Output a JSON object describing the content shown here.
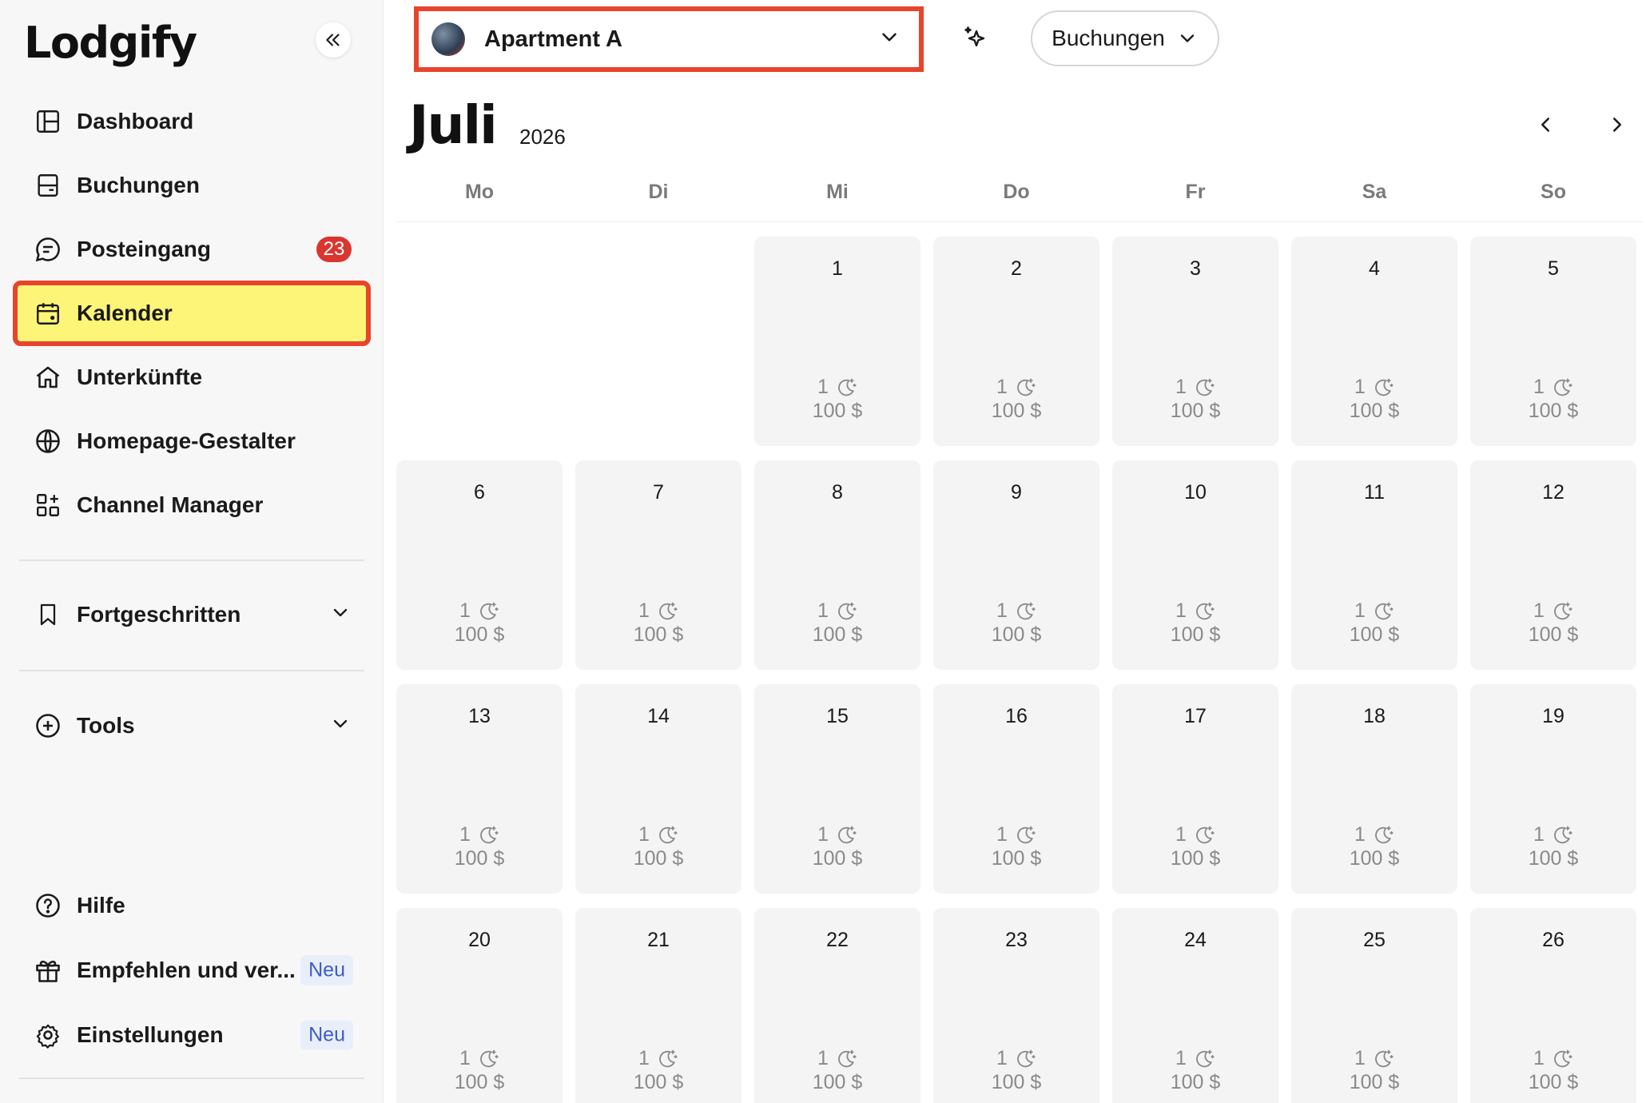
{
  "app": {
    "logo": "Lodgify"
  },
  "sidebar": {
    "items": [
      {
        "id": "dashboard",
        "label": "Dashboard",
        "icon": "dashboard-icon"
      },
      {
        "id": "buchungen",
        "label": "Buchungen",
        "icon": "bookings-icon"
      },
      {
        "id": "posteingang",
        "label": "Posteingang",
        "icon": "chat-icon",
        "badge": "23"
      },
      {
        "id": "kalender",
        "label": "Kalender",
        "icon": "calendar-icon",
        "active": true
      },
      {
        "id": "unterkuenfte",
        "label": "Unterkünfte",
        "icon": "home-icon"
      },
      {
        "id": "homepage",
        "label": "Homepage-Gestalter",
        "icon": "globe-icon"
      },
      {
        "id": "channel",
        "label": "Channel Manager",
        "icon": "apps-add-icon"
      }
    ],
    "sections": [
      {
        "id": "fortgeschritten",
        "label": "Fortgeschritten",
        "icon": "bookmark-icon"
      },
      {
        "id": "tools",
        "label": "Tools",
        "icon": "plus-circle-icon"
      }
    ],
    "bottom": [
      {
        "id": "hilfe",
        "label": "Hilfe",
        "icon": "help-icon"
      },
      {
        "id": "empfehlen",
        "label": "Empfehlen und ver...",
        "icon": "gift-icon",
        "tag": "Neu"
      },
      {
        "id": "einstellungen",
        "label": "Einstellungen",
        "icon": "gear-icon",
        "tag": "Neu"
      }
    ]
  },
  "header": {
    "property": "Apartment A",
    "view_label": "Buchungen"
  },
  "calendar": {
    "month": "Juli",
    "year": "2026",
    "weekdays": [
      "Mo",
      "Di",
      "Mi",
      "Do",
      "Fr",
      "Sa",
      "So"
    ],
    "days": [
      {
        "num": "1",
        "nights": "1",
        "price": "100 $"
      },
      {
        "num": "2",
        "nights": "1",
        "price": "100 $"
      },
      {
        "num": "3",
        "nights": "1",
        "price": "100 $"
      },
      {
        "num": "4",
        "nights": "1",
        "price": "100 $"
      },
      {
        "num": "5",
        "nights": "1",
        "price": "100 $"
      },
      {
        "num": "6",
        "nights": "1",
        "price": "100 $"
      },
      {
        "num": "7",
        "nights": "1",
        "price": "100 $"
      },
      {
        "num": "8",
        "nights": "1",
        "price": "100 $"
      },
      {
        "num": "9",
        "nights": "1",
        "price": "100 $"
      },
      {
        "num": "10",
        "nights": "1",
        "price": "100 $"
      },
      {
        "num": "11",
        "nights": "1",
        "price": "100 $"
      },
      {
        "num": "12",
        "nights": "1",
        "price": "100 $"
      },
      {
        "num": "13",
        "nights": "1",
        "price": "100 $"
      },
      {
        "num": "14",
        "nights": "1",
        "price": "100 $"
      },
      {
        "num": "15",
        "nights": "1",
        "price": "100 $"
      },
      {
        "num": "16",
        "nights": "1",
        "price": "100 $"
      },
      {
        "num": "17",
        "nights": "1",
        "price": "100 $"
      },
      {
        "num": "18",
        "nights": "1",
        "price": "100 $"
      },
      {
        "num": "19",
        "nights": "1",
        "price": "100 $"
      },
      {
        "num": "20",
        "nights": "1",
        "price": "100 $"
      },
      {
        "num": "21",
        "nights": "1",
        "price": "100 $"
      },
      {
        "num": "22",
        "nights": "1",
        "price": "100 $"
      },
      {
        "num": "23",
        "nights": "1",
        "price": "100 $"
      },
      {
        "num": "24",
        "nights": "1",
        "price": "100 $"
      },
      {
        "num": "25",
        "nights": "1",
        "price": "100 $"
      },
      {
        "num": "26",
        "nights": "1",
        "price": "100 $"
      }
    ]
  },
  "colors": {
    "highlight_outline": "#e8442d",
    "active_bg": "#fdf578",
    "badge_red": "#d9362f",
    "tag_blue": "#3c5cc4"
  }
}
